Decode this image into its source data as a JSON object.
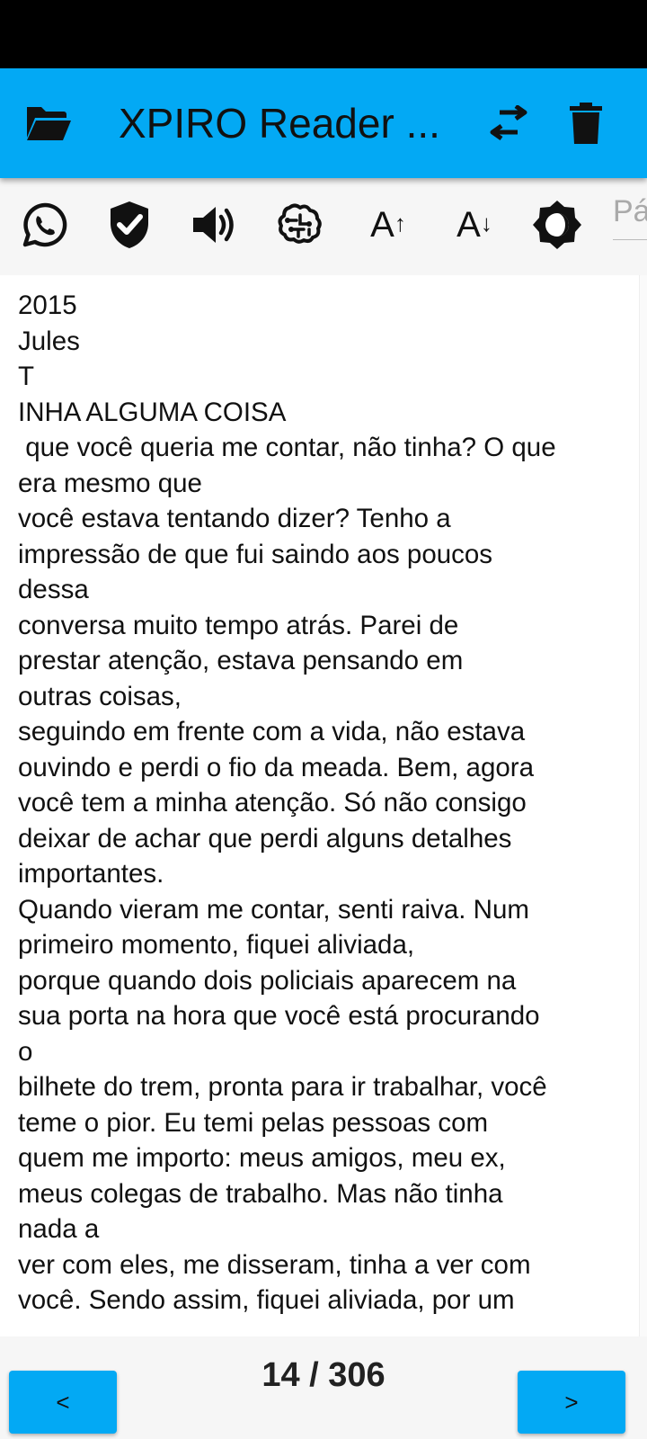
{
  "app_bar": {
    "title": "XPIRO Reader ...",
    "icons": {
      "folder": "folder-open-icon",
      "swap": "swap-horizontal-icon",
      "delete": "trash-icon"
    },
    "color": "#03A9F4"
  },
  "toolbar": {
    "icons": [
      "whatsapp-icon",
      "shield-check-icon",
      "volume-icon",
      "brain-icon",
      "font-increase-icon",
      "font-decrease-icon",
      "brightness-icon"
    ],
    "font_increase_label": "A",
    "font_decrease_label": "A",
    "page_input_placeholder": "Página"
  },
  "reader": {
    "text": "2015\nJules\nT\nINHA ALGUMA COISA\n que você queria me contar, não tinha? O que\nera mesmo que\nvocê estava tentando dizer? Tenho a\nimpressão de que fui saindo aos poucos\ndessa\nconversa muito tempo atrás. Parei de\nprestar atenção, estava pensando em\noutras coisas,\nseguindo em frente com a vida, não estava\nouvindo e perdi o fio da meada. Bem, agora\nvocê tem a minha atenção. Só não consigo\ndeixar de achar que perdi alguns detalhes\nimportantes.\nQuando vieram me contar, senti raiva. Num\nprimeiro momento, fiquei aliviada,\nporque quando dois policiais aparecem na\nsua porta na hora que você está procurando\no\nbilhete do trem, pronta para ir trabalhar, você\nteme o pior. Eu temi pelas pessoas com\nquem me importo: meus amigos, meu ex,\nmeus colegas de trabalho. Mas não tinha\nnada a\nver com eles, me disseram, tinha a ver com\nvocê. Sendo assim, fiquei aliviada, por um"
  },
  "pagination": {
    "prev_label": "<",
    "next_label": ">",
    "indicator": "14 / 306",
    "current_page": 14,
    "total_pages": 306
  }
}
